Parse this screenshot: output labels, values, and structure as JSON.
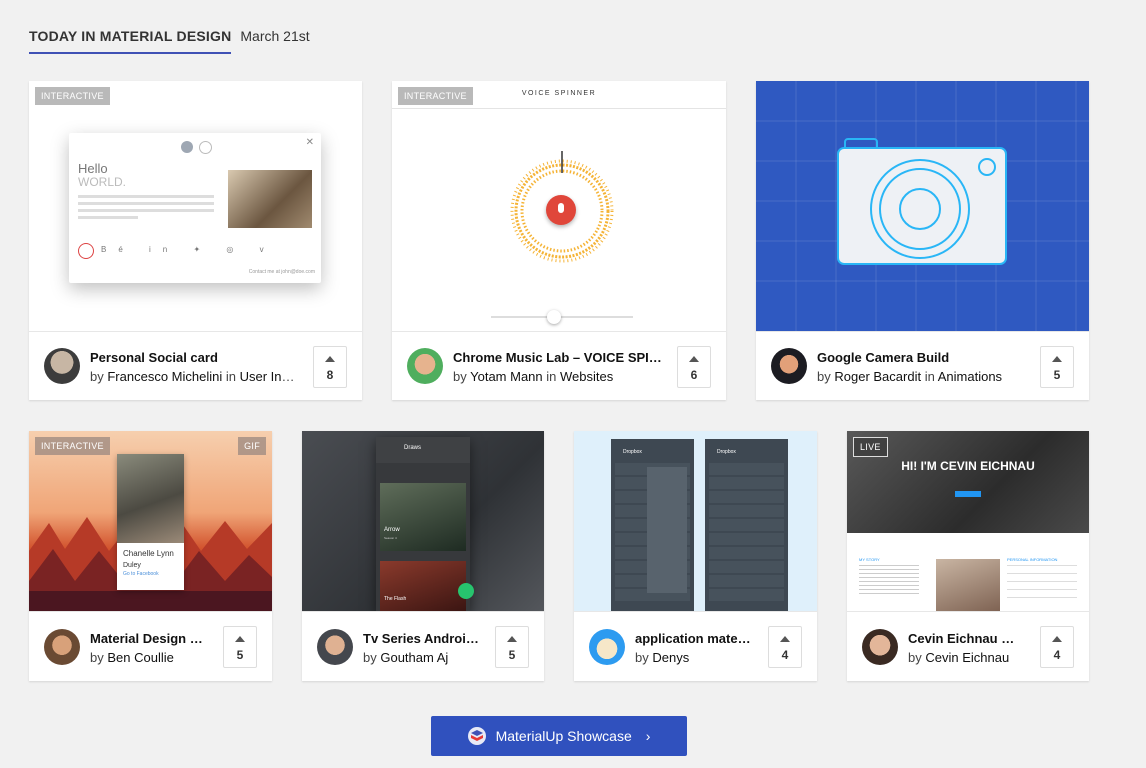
{
  "header": {
    "title": "TODAY IN MATERIAL DESIGN",
    "date": "March 21st"
  },
  "cta": {
    "label": "MaterialUp Showcase",
    "chevron": "›"
  },
  "by_word": "by",
  "in_word": "in",
  "cards": [
    {
      "title": "Personal Social card",
      "author": "Francesco Michelini",
      "category": "User Int…",
      "votes": "8",
      "badge_left": "INTERACTIVE",
      "preview": {
        "hello": "Hello",
        "world": "WORLD.",
        "contact": "Contact me at john@doe.com"
      }
    },
    {
      "title": "Chrome Music Lab – VOICE SPI…",
      "author": "Yotam Mann",
      "category": "Websites",
      "votes": "6",
      "badge_left": "INTERACTIVE",
      "preview": {
        "heading": "VOICE SPINNER"
      }
    },
    {
      "title": "Google Camera Build",
      "author": "Roger Bacardit",
      "category": "Animations",
      "votes": "5"
    },
    {
      "title": "Material Design …",
      "author": "Ben Coullie",
      "votes": "5",
      "badge_left": "INTERACTIVE",
      "badge_right": "GIF",
      "preview": {
        "name1": "Chanelle Lynn",
        "name2": "Duley",
        "link": "Go to Facebook"
      }
    },
    {
      "title": "Tv Series Androi…",
      "author": "Goutham Aj",
      "votes": "5",
      "preview": {
        "app": "Draws",
        "show1": "Arrow",
        "show1_sub": "Season 4",
        "show2": "The Flash"
      }
    },
    {
      "title": "application mate…",
      "author": "Denys",
      "votes": "4",
      "preview": {
        "app1": "Dropbox",
        "app2": "Dropbox"
      }
    },
    {
      "title": "Cevin Eichnau W…",
      "author": "Cevin Eichnau",
      "votes": "4",
      "badge_left": "LIVE",
      "preview": {
        "hero": "HI! I'M CEVIN EICHNAU",
        "story": "MY STORY",
        "info": "PERSONAL INFORMATION"
      }
    }
  ],
  "colors": {
    "accent": "#3f51b5",
    "cta": "#3051be",
    "camera_bg": "#2f59c1",
    "spinner": "#f5b335",
    "mic": "#e0463a"
  }
}
